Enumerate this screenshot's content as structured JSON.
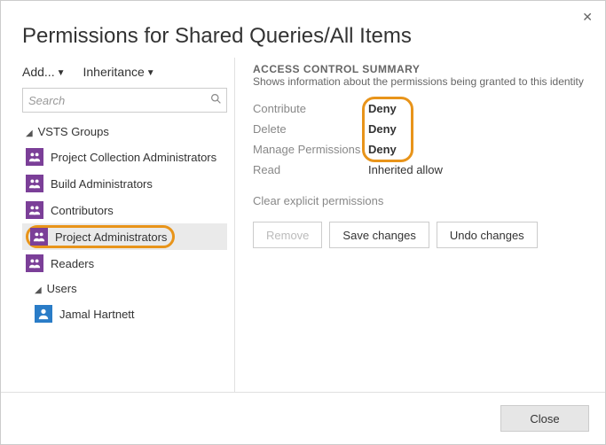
{
  "dialog": {
    "title": "Permissions for Shared Queries/All Items"
  },
  "toolbar": {
    "add_label": "Add...",
    "inherit_label": "Inheritance"
  },
  "search": {
    "placeholder": "Search"
  },
  "groups": {
    "vsts_header": "VSTS Groups",
    "items": {
      "pca": "Project Collection Administrators",
      "build": "Build Administrators",
      "contrib": "Contributors",
      "proj": "Project Administrators",
      "readers": "Readers"
    },
    "users_header": "Users",
    "users": {
      "jamal": "Jamal Hartnett"
    }
  },
  "acs": {
    "title": "ACCESS CONTROL SUMMARY",
    "subtitle": "Shows information about the permissions being granted to this identity",
    "perms": {
      "contribute_label": "Contribute",
      "contribute_val": "Deny",
      "delete_label": "Delete",
      "delete_val": "Deny",
      "manage_label": "Manage Permissions",
      "manage_val": "Deny",
      "read_label": "Read",
      "read_val": "Inherited allow"
    },
    "clear_link": "Clear explicit permissions",
    "buttons": {
      "remove": "Remove",
      "save": "Save changes",
      "undo": "Undo changes"
    }
  },
  "footer": {
    "close": "Close"
  }
}
